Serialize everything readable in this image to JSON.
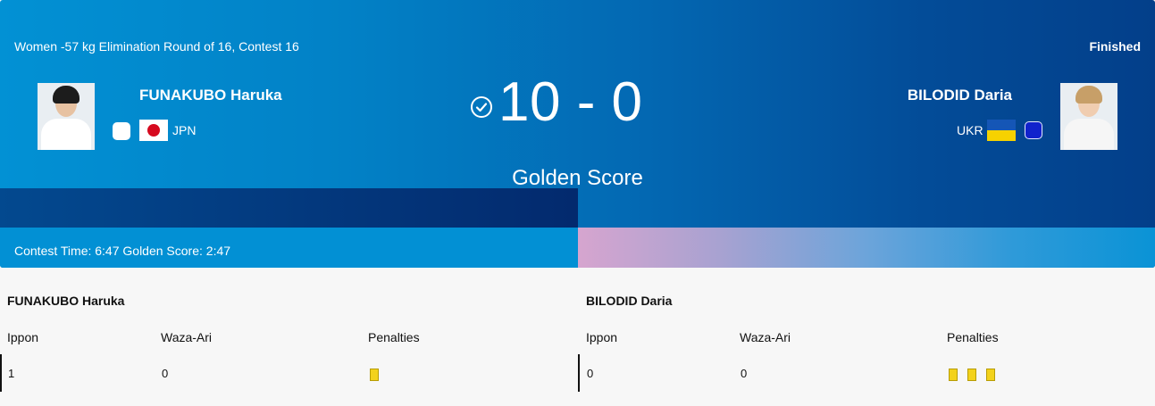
{
  "header": {
    "event_title": "Women -57 kg Elimination Round of 16, Contest 16",
    "status": "Finished",
    "score": "10 - 0",
    "golden_score_label": "Golden Score",
    "contest_time": "Contest Time: 6:47 Golden Score: 2:47"
  },
  "athletes": {
    "left": {
      "name": "FUNAKUBO Haruka",
      "nation": "JPN",
      "judogi_color": "#ffffff",
      "flag": "japan-flag-icon"
    },
    "right": {
      "name": "BILODID Daria",
      "nation": "UKR",
      "judogi_color": "#1122cc",
      "flag": "ukraine-flag-icon"
    }
  },
  "stats": {
    "columns": {
      "ippon": "Ippon",
      "waza_ari": "Waza-Ari",
      "penalties": "Penalties"
    },
    "left": {
      "name": "FUNAKUBO Haruka",
      "ippon": "1",
      "waza_ari": "0",
      "penalties": 1
    },
    "right": {
      "name": "BILODID Daria",
      "ippon": "0",
      "waza_ari": "0",
      "penalties": 3
    }
  },
  "colors": {
    "penalty_card": "#f3d21c",
    "hero_blue": "#0291d4",
    "hero_dark": "#033f8a"
  }
}
